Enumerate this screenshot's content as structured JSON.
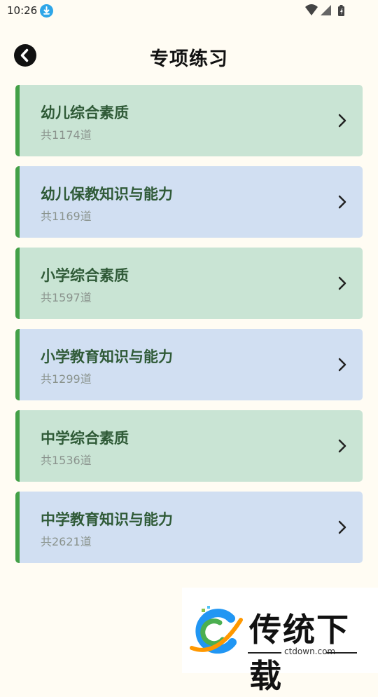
{
  "status_bar": {
    "time": "10:26"
  },
  "header": {
    "title": "专项练习"
  },
  "cards": [
    {
      "title": "幼儿综合素质",
      "count": "共1174道",
      "theme": "green"
    },
    {
      "title": "幼儿保教知识与能力",
      "count": "共1169道",
      "theme": "blue"
    },
    {
      "title": "小学综合素质",
      "count": "共1597道",
      "theme": "green"
    },
    {
      "title": "小学教育知识与能力",
      "count": "共1299道",
      "theme": "blue"
    },
    {
      "title": "中学综合素质",
      "count": "共1536道",
      "theme": "green"
    },
    {
      "title": "中学教育知识与能力",
      "count": "共2621道",
      "theme": "blue"
    }
  ],
  "watermark": {
    "brand": "传统下载",
    "url": "ctdown.com"
  },
  "colors": {
    "accent": "#43a047",
    "green_card": "#c9e4d4",
    "blue_card": "#d1dff2",
    "title_text": "#2f5a37",
    "background": "#fffcf3"
  },
  "icons": {
    "back": "back-arrow-icon",
    "row": "chevron-right-icon"
  }
}
